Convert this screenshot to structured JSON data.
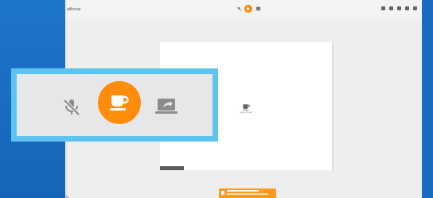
{
  "app": {
    "title": "aifinnae"
  },
  "toolbar": {
    "center_icons": [
      "mic-muted-icon",
      "coffee-cup-icon",
      "screen-share-icon"
    ],
    "right_icons": [
      "people-icon",
      "chat-icon",
      "grid-icon",
      "gear-icon",
      "close-icon"
    ]
  },
  "stage": {
    "label": "Away Break"
  },
  "toast": {
    "line1": "",
    "line2": ""
  },
  "colors": {
    "accent": "#ff8c0a",
    "highlight_border": "#5ec3ef",
    "desktop": "#1a6fc4"
  }
}
